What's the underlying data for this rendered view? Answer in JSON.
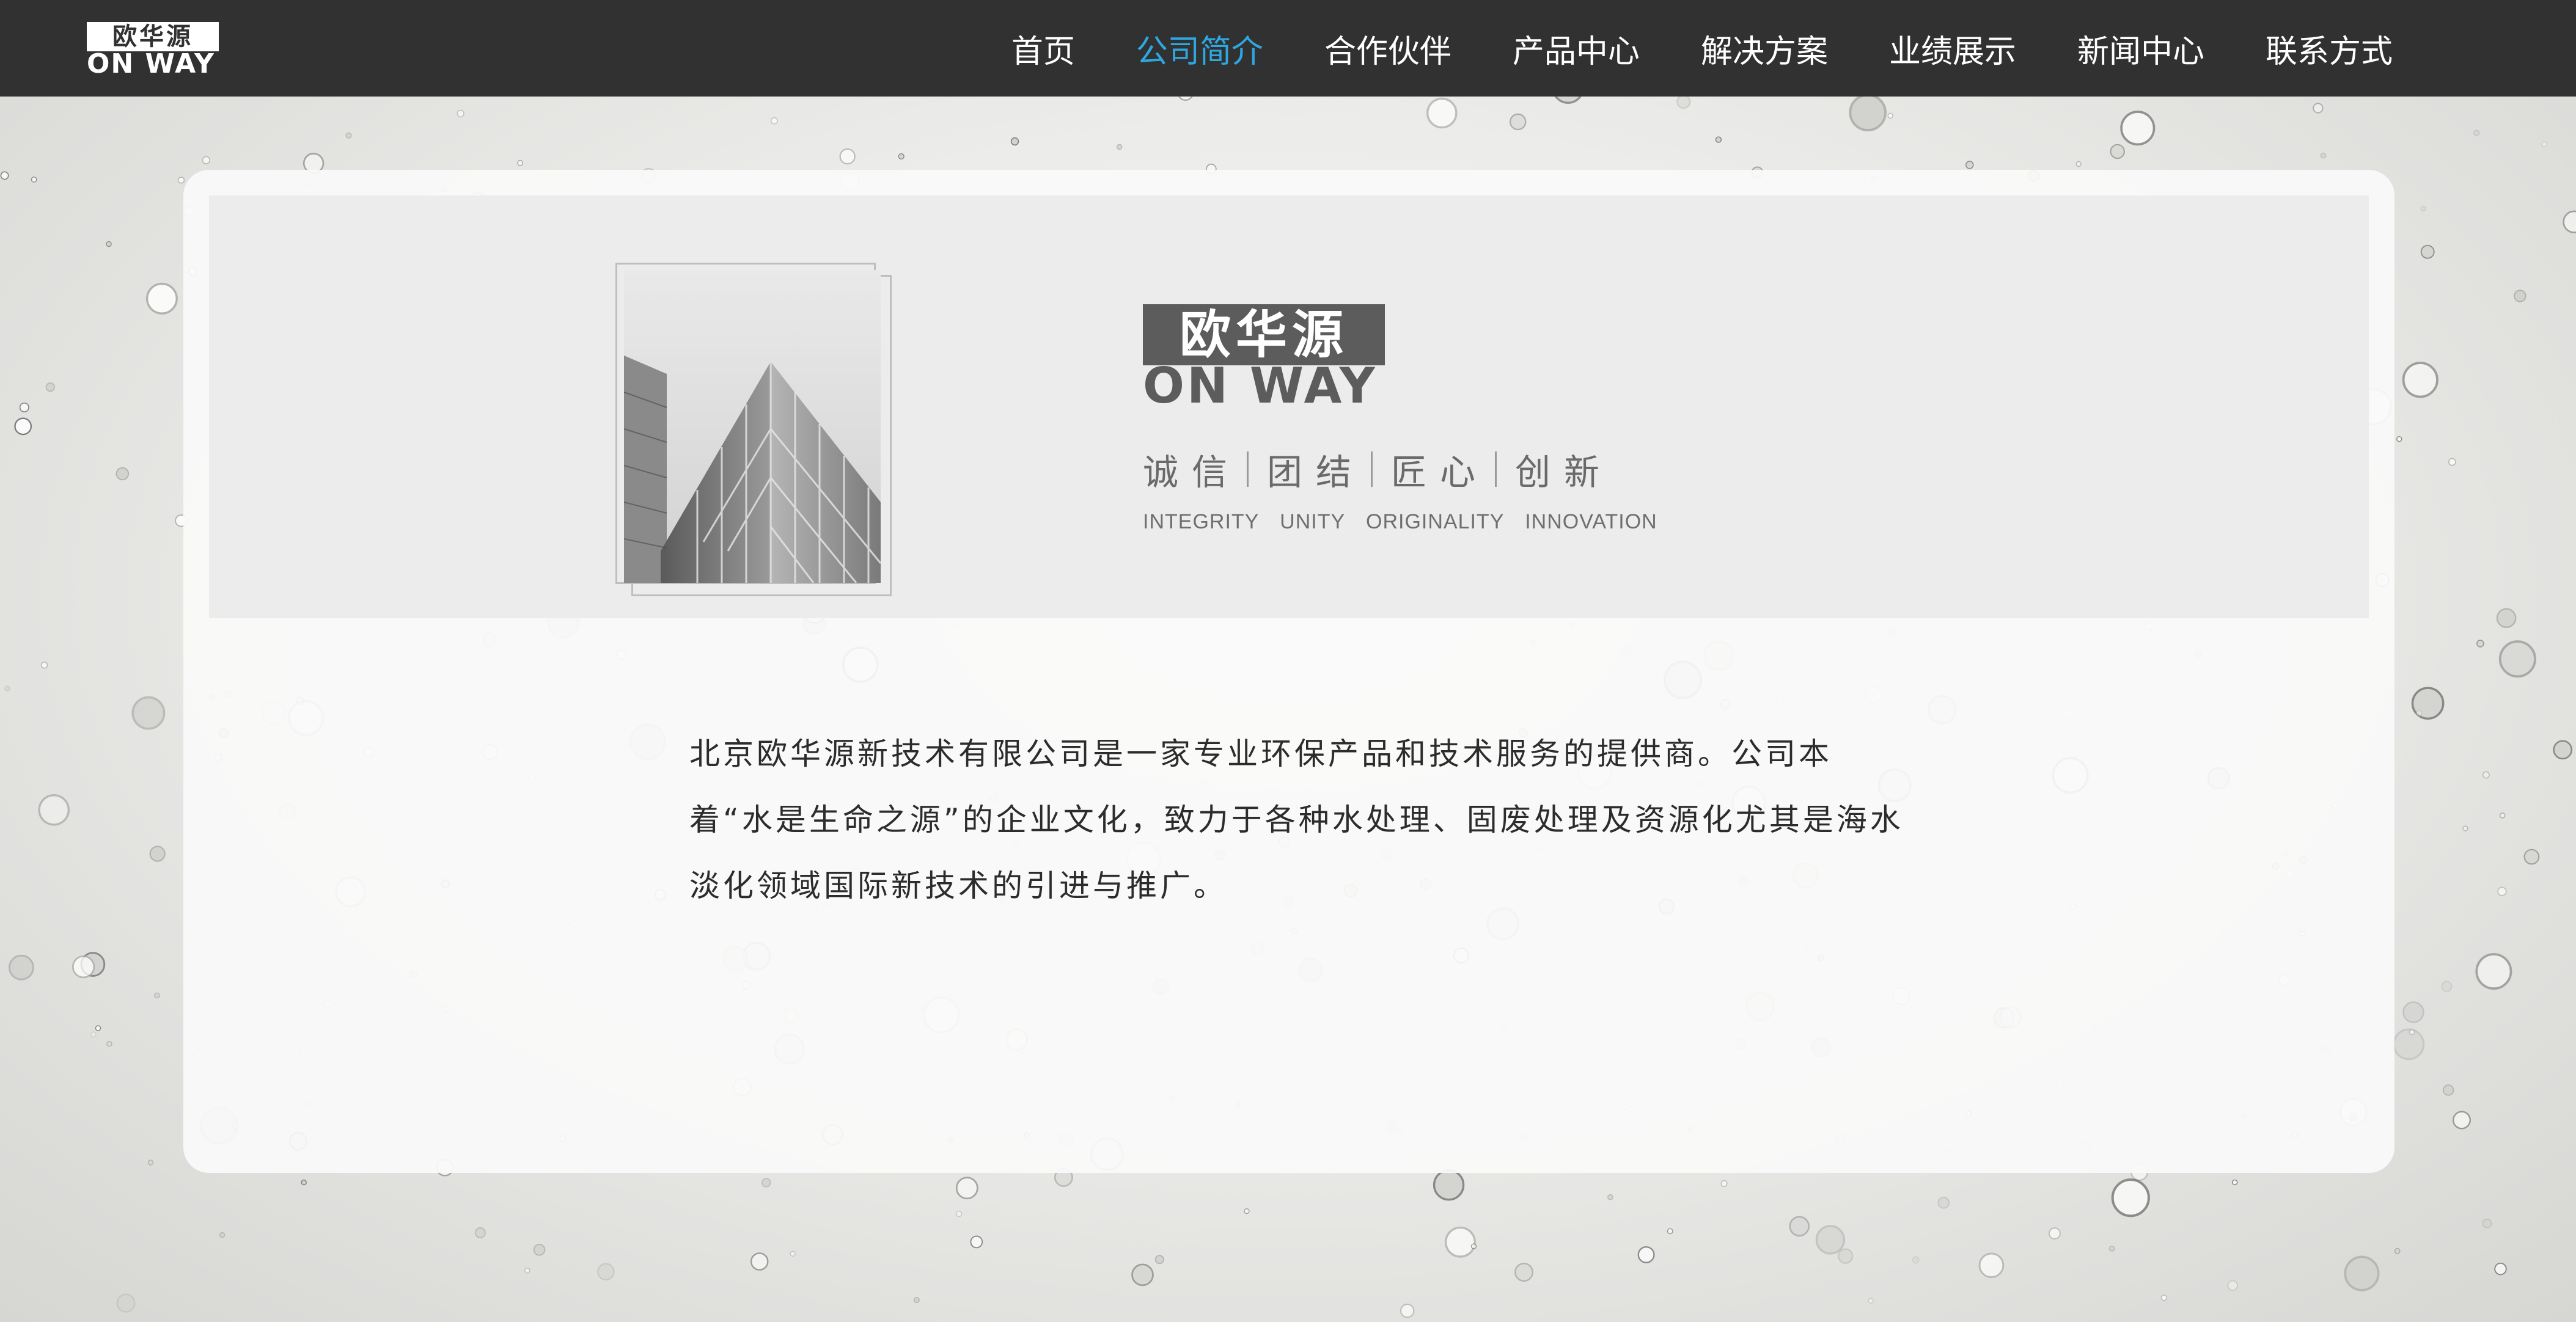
{
  "nav": {
    "logo": {
      "cn": "欧华源",
      "en": "ON WAY"
    },
    "items": [
      {
        "label": "首页",
        "active": false
      },
      {
        "label": "公司简介",
        "active": true
      },
      {
        "label": "合作伙伴",
        "active": false
      },
      {
        "label": "产品中心",
        "active": false
      },
      {
        "label": "解决方案",
        "active": false
      },
      {
        "label": "业绩展示",
        "active": false
      },
      {
        "label": "新闻中心",
        "active": false
      },
      {
        "label": "联系方式",
        "active": false
      }
    ]
  },
  "banner": {
    "brand": {
      "cn": "欧华源",
      "en": "ON WAY"
    },
    "values": [
      "诚信",
      "团结",
      "匠心",
      "创新"
    ],
    "values_en": "INTEGRITY UNITY ORIGINALITY INNOVATION"
  },
  "intro": {
    "text": "北京欧华源新技术有限公司是一家专业环保产品和技术服务的提供商。公司本着“水是生命之源”的企业文化，致力于各种水处理、固废处理及资源化尤其是海水淡化领域国际新技术的引进与推广。"
  },
  "colors": {
    "nav_bg": "#313131",
    "nav_active": "#2ea7e0",
    "banner_bg": "#ececec",
    "logo_gray": "#5c5c5c"
  }
}
